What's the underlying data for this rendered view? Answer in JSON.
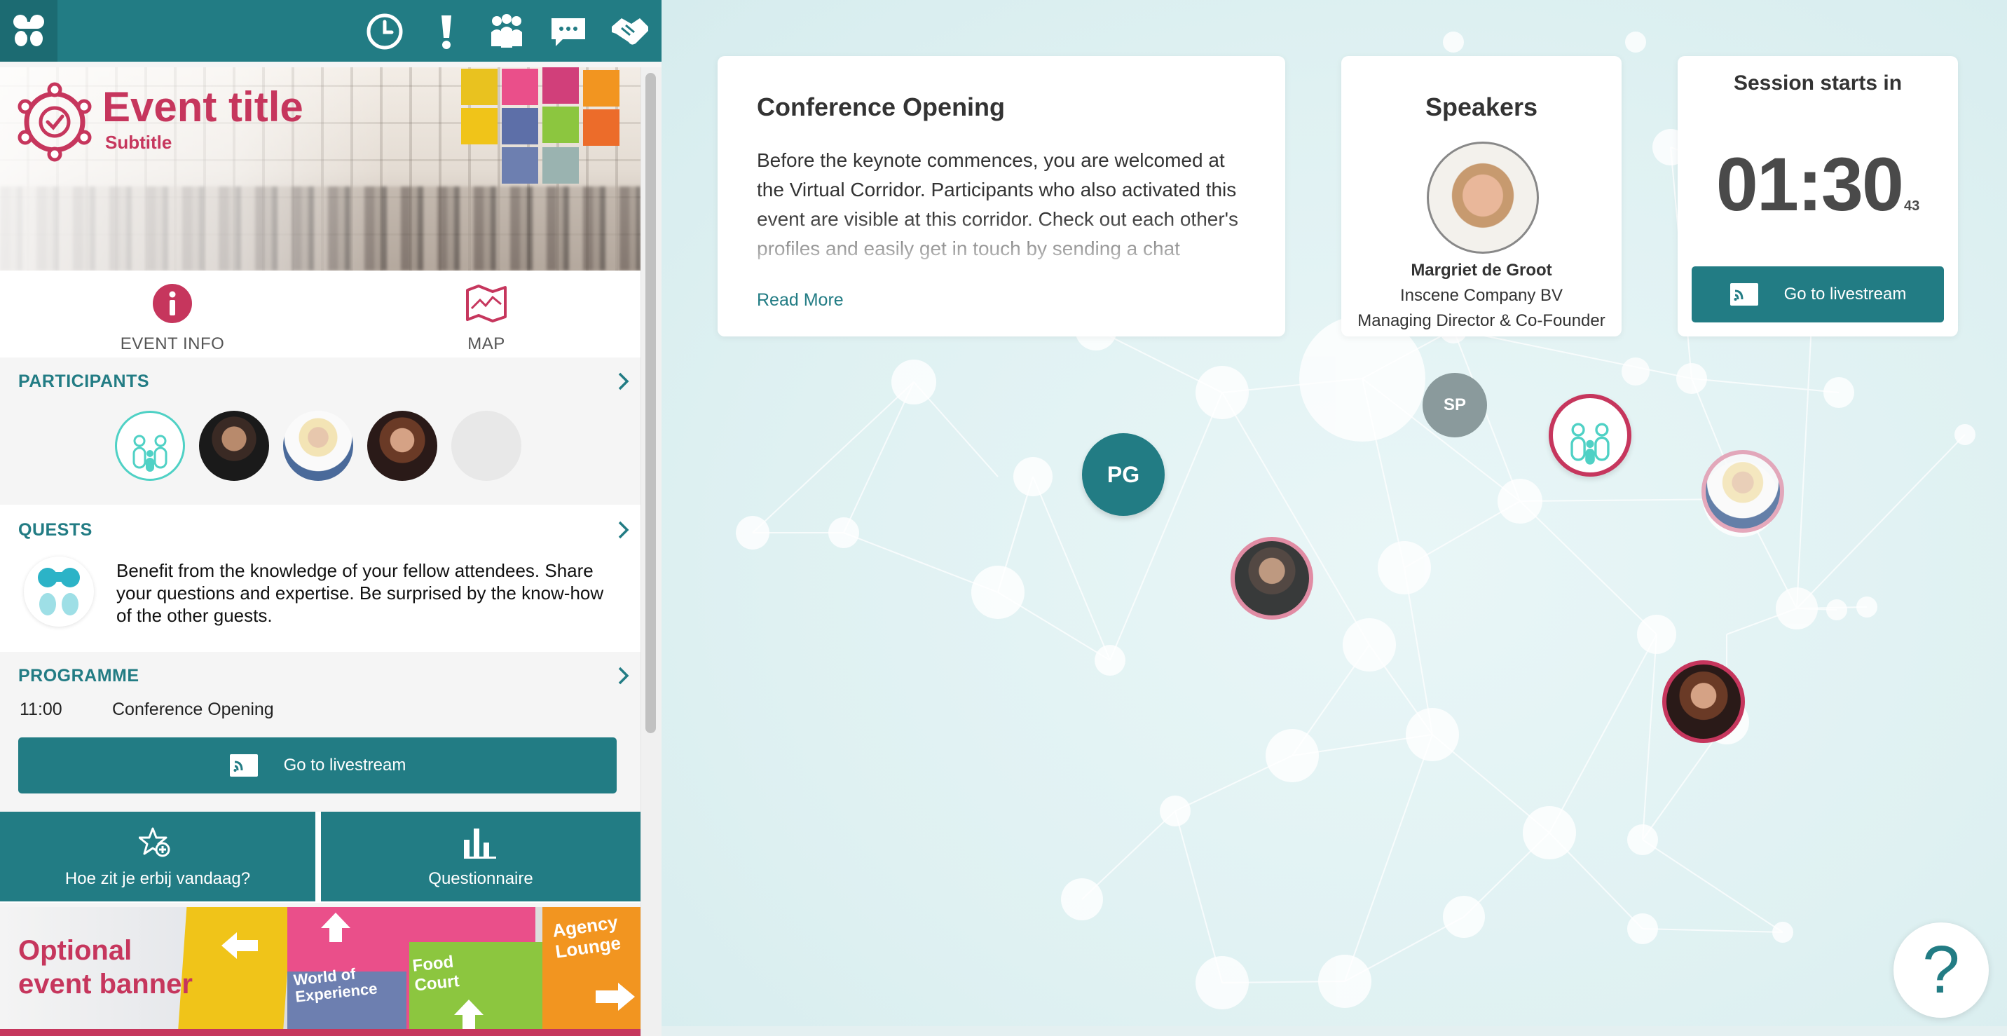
{
  "topbar": {
    "logo_icon": "app-logo-icon",
    "icons": [
      "clock-icon",
      "alert-icon",
      "people-icon",
      "chat-icon",
      "handshake-icon"
    ]
  },
  "event": {
    "title": "Event title",
    "subtitle": "Subtitle"
  },
  "info_tabs": [
    {
      "label": "EVENT INFO",
      "icon": "info-icon"
    },
    {
      "label": "MAP",
      "icon": "map-icon"
    }
  ],
  "participants": {
    "title": "PARTICIPANTS"
  },
  "quests": {
    "title": "QUESTS",
    "text": "Benefit from the knowledge of your fellow attendees. Share your questions and expertise. Be surprised by the know-how of the other guests."
  },
  "programme": {
    "title": "PROGRAMME",
    "items": [
      {
        "time": "11:00",
        "name": "Conference Opening"
      }
    ],
    "livestream_label": "Go to livestream"
  },
  "action_tiles": [
    {
      "label": "Hoe zit je erbij vandaag?",
      "icon": "star-plus-icon"
    },
    {
      "label": "Questionnaire",
      "icon": "bar-chart-icon"
    }
  ],
  "banner": {
    "title_line1": "Optional",
    "title_line2": "event banner",
    "signs": [
      "World of Experience",
      "Food Court",
      "Agency Lounge"
    ]
  },
  "conference_card": {
    "title": "Conference Opening",
    "description": "Before the keynote commences, you are welcomed at the Virtual Corridor. Participants who also activated this event are visible at this corridor. Check out each other's profiles and easily get in touch by sending a chat notification.",
    "read_more": "Read More"
  },
  "speakers_card": {
    "title": "Speakers",
    "name": "Margriet de Groot",
    "company": "Inscene Company BV",
    "role": "Managing Director & Co-Founder"
  },
  "session_card": {
    "title": "Session starts in",
    "timer_main": "01:30",
    "timer_seconds": "43",
    "livestream_label": "Go to livestream"
  },
  "corridor_nodes": {
    "pg_initials": "PG",
    "sp_initials": "SP"
  },
  "help": {
    "label": "?"
  },
  "colors": {
    "brand_teal": "#227c84",
    "brand_pink": "#c6365d",
    "avatar_teal": "#4fd1c5"
  }
}
